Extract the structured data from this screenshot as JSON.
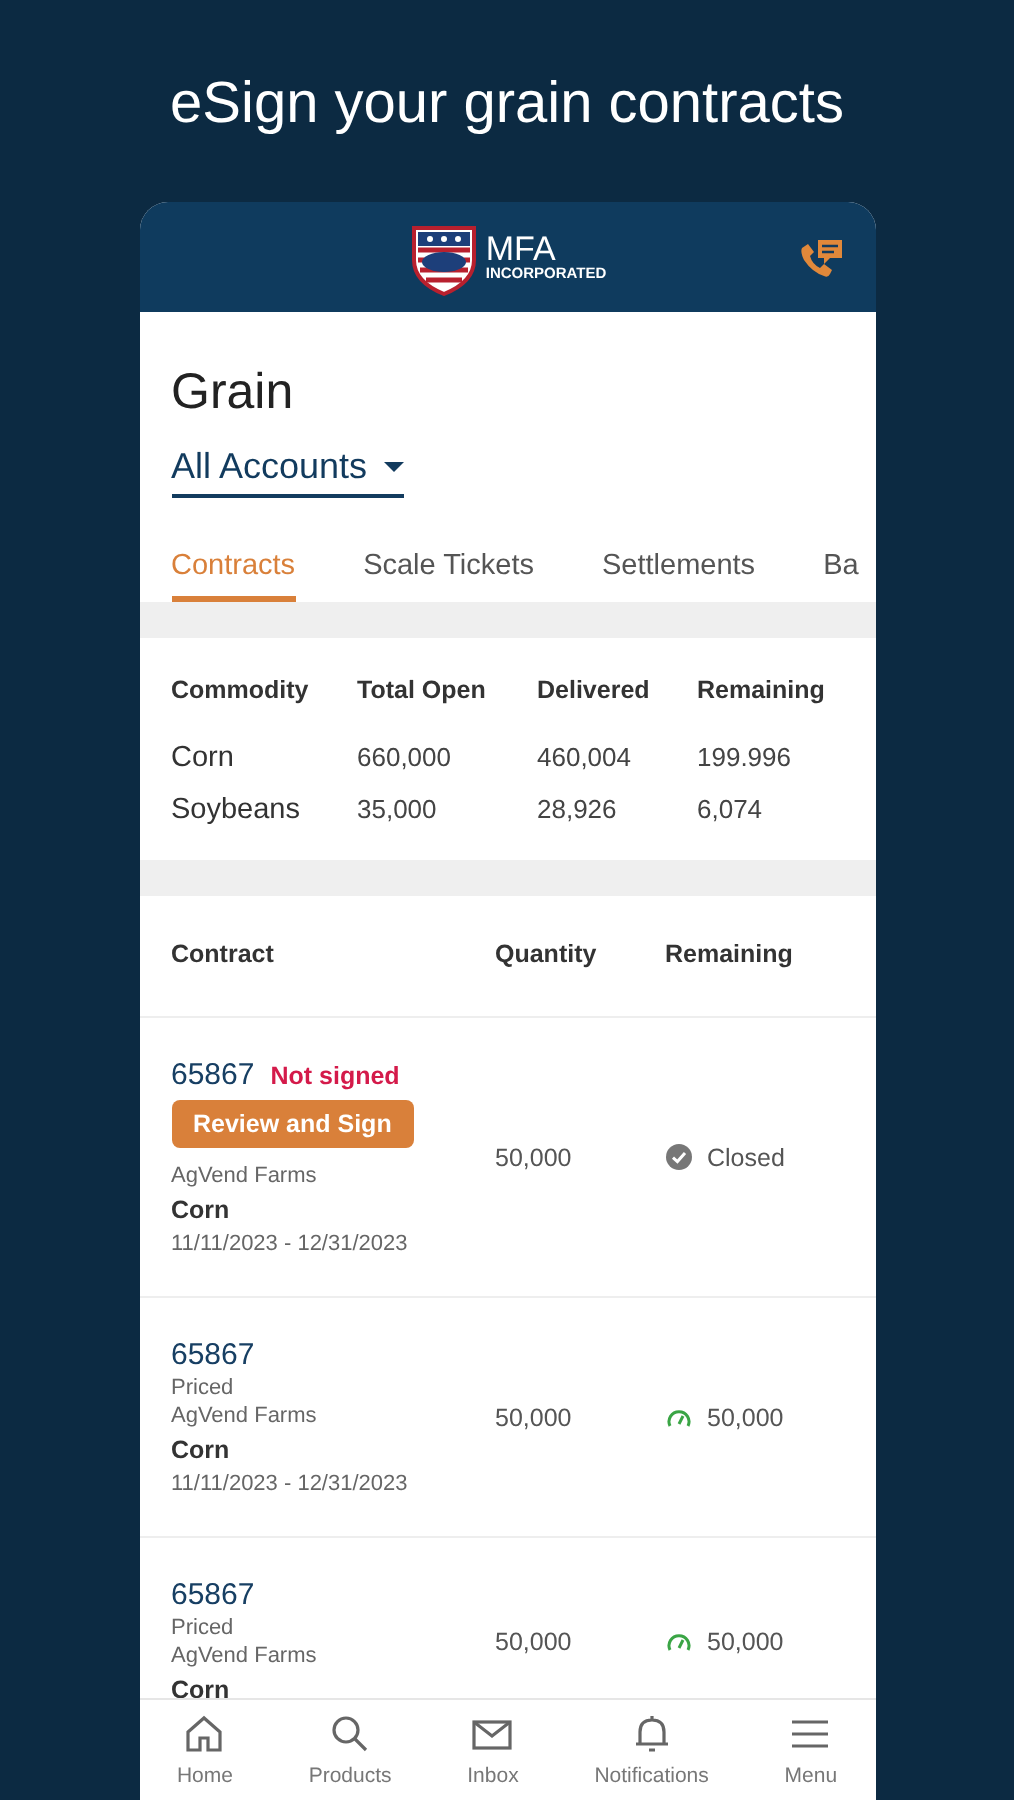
{
  "headline": "eSign your grain contracts",
  "app_header": {
    "brand": "MFA",
    "brand_sub": "INCORPORATED"
  },
  "page_title": "Grain",
  "account_selector": {
    "value": "All Accounts"
  },
  "tabs": [
    {
      "label": "Contracts",
      "selected": true
    },
    {
      "label": "Scale Tickets",
      "selected": false
    },
    {
      "label": "Settlements",
      "selected": false
    },
    {
      "label": "Ba",
      "selected": false
    }
  ],
  "summary": {
    "columns": [
      "Commodity",
      "Total Open",
      "Delivered",
      "Remaining"
    ],
    "rows": [
      [
        "Corn",
        "660,000",
        "460,004",
        "199.996"
      ],
      [
        "Soybeans",
        "35,000",
        "28,926",
        "6,074"
      ]
    ]
  },
  "contracts": {
    "columns": [
      "Contract",
      "Quantity",
      "Remaining"
    ],
    "rows": [
      {
        "number": "65867",
        "sign_status": "Not signed",
        "action": "Review and Sign",
        "farm": "AgVend Farms",
        "commodity": "Corn",
        "dates": "11/11/2023 - 12/31/2023",
        "quantity": "50,000",
        "kind": "closed",
        "remaining": "Closed"
      },
      {
        "number": "65867",
        "pricing": "Priced",
        "farm": "AgVend Farms",
        "commodity": "Corn",
        "dates": "11/11/2023 - 12/31/2023",
        "quantity": "50,000",
        "kind": "open",
        "remaining": "50,000"
      },
      {
        "number": "65867",
        "pricing": "Priced",
        "farm": "AgVend Farms",
        "commodity": "Corn",
        "quantity": "50,000",
        "kind": "open",
        "remaining": "50,000"
      }
    ]
  },
  "bottom_nav": [
    {
      "label": "Home",
      "kind": "home"
    },
    {
      "label": "Products",
      "kind": "search"
    },
    {
      "label": "Inbox",
      "kind": "mail"
    },
    {
      "label": "Notifications",
      "kind": "bell"
    },
    {
      "label": "Menu",
      "kind": "menu"
    }
  ]
}
